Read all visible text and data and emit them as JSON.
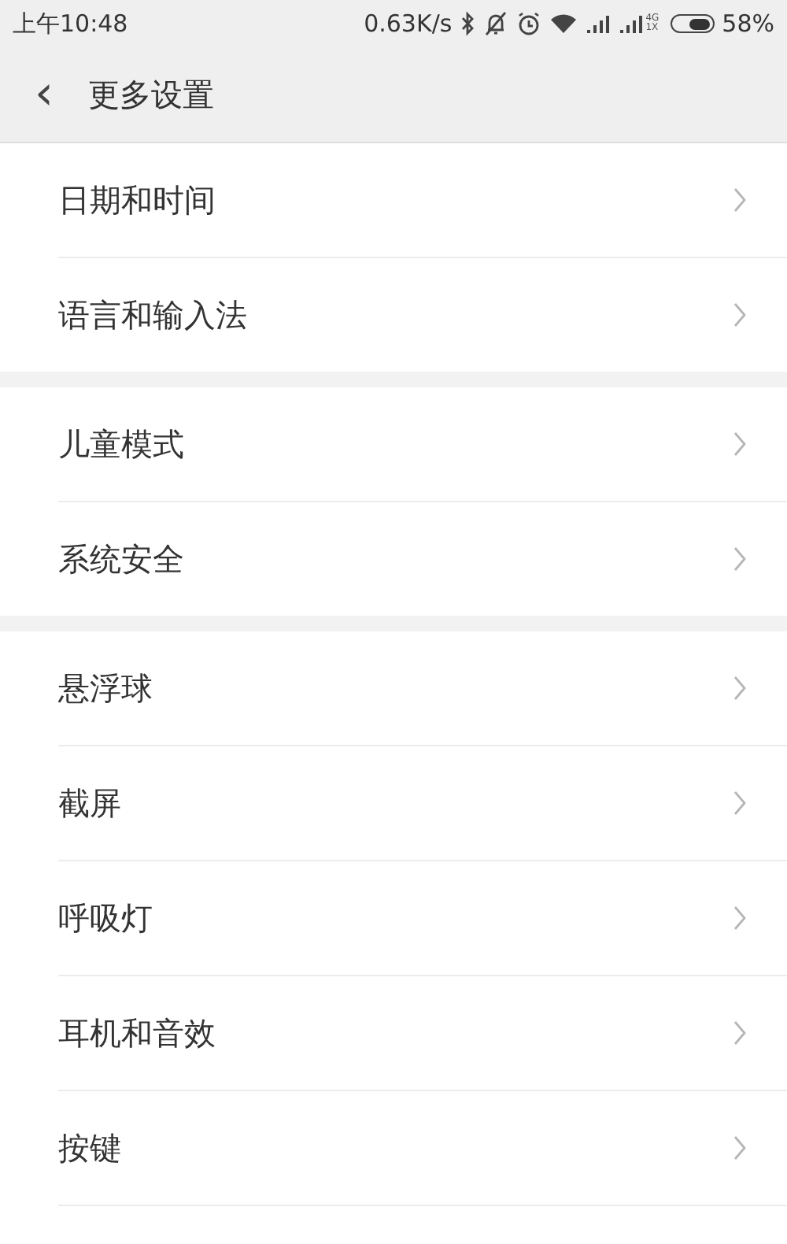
{
  "status_bar": {
    "time": "上午10:48",
    "speed": "0.63K/s",
    "network_labels": [
      "4G",
      "1X"
    ],
    "battery": "58%"
  },
  "header": {
    "back": "‹",
    "title": "更多设置"
  },
  "groups": [
    {
      "items": [
        {
          "label": "日期和时间"
        },
        {
          "label": "语言和输入法"
        }
      ]
    },
    {
      "items": [
        {
          "label": "儿童模式"
        },
        {
          "label": "系统安全"
        }
      ]
    },
    {
      "items": [
        {
          "label": "悬浮球"
        },
        {
          "label": "截屏"
        },
        {
          "label": "呼吸灯"
        },
        {
          "label": "耳机和音效"
        },
        {
          "label": "按键"
        }
      ]
    }
  ]
}
